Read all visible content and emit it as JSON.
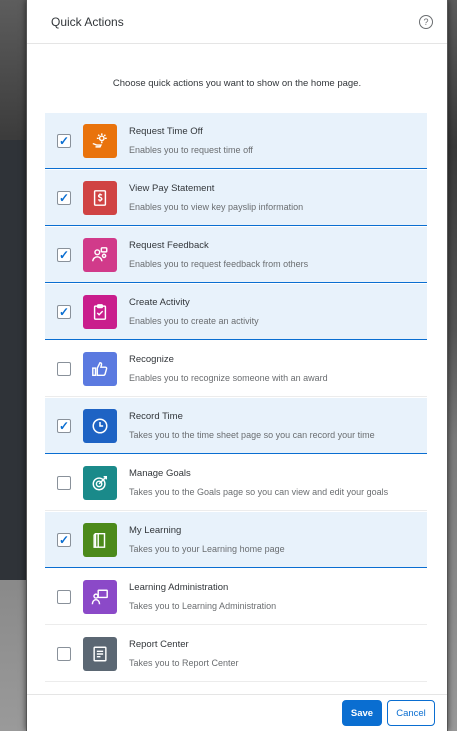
{
  "dialog": {
    "title": "Quick Actions",
    "help_icon": "help-circle-icon",
    "intro": "Choose quick actions you want to show on the home page."
  },
  "items": [
    {
      "name": "Request Time Off",
      "desc": "Enables you to request time off",
      "checked": true,
      "color": "#e9730c",
      "icon": "sun-on-hand-icon"
    },
    {
      "name": "View Pay Statement",
      "desc": "Enables you to view key payslip information",
      "checked": true,
      "color": "#d04343",
      "icon": "dollar-document-icon"
    },
    {
      "name": "Request Feedback",
      "desc": "Enables you to request feedback from others",
      "checked": true,
      "color": "#d13a8a",
      "icon": "people-feedback-icon"
    },
    {
      "name": "Create Activity",
      "desc": "Enables you to create an activity",
      "checked": true,
      "color": "#c91d8c",
      "icon": "clipboard-icon"
    },
    {
      "name": "Recognize",
      "desc": "Enables you to recognize someone with an award",
      "checked": false,
      "color": "#5b7ae0",
      "icon": "thumbs-up-icon"
    },
    {
      "name": "Record Time",
      "desc": "Takes you to the time sheet page so you can record your time",
      "checked": true,
      "color": "#1e63c4",
      "icon": "clock-icon"
    },
    {
      "name": "Manage Goals",
      "desc": "Takes you to the Goals page so you can view and edit your goals",
      "checked": false,
      "color": "#1a8a8a",
      "icon": "target-icon"
    },
    {
      "name": "My Learning",
      "desc": "Takes you to your Learning home page",
      "checked": true,
      "color": "#4c8a1a",
      "icon": "book-icon"
    },
    {
      "name": "Learning Administration",
      "desc": "Takes you to Learning Administration",
      "checked": false,
      "color": "#8b49c8",
      "icon": "teacher-board-icon"
    },
    {
      "name": "Report Center",
      "desc": "Takes you to Report Center",
      "checked": false,
      "color": "#5b6773",
      "icon": "report-icon"
    }
  ],
  "footer": {
    "save_label": "Save",
    "cancel_label": "Cancel"
  }
}
